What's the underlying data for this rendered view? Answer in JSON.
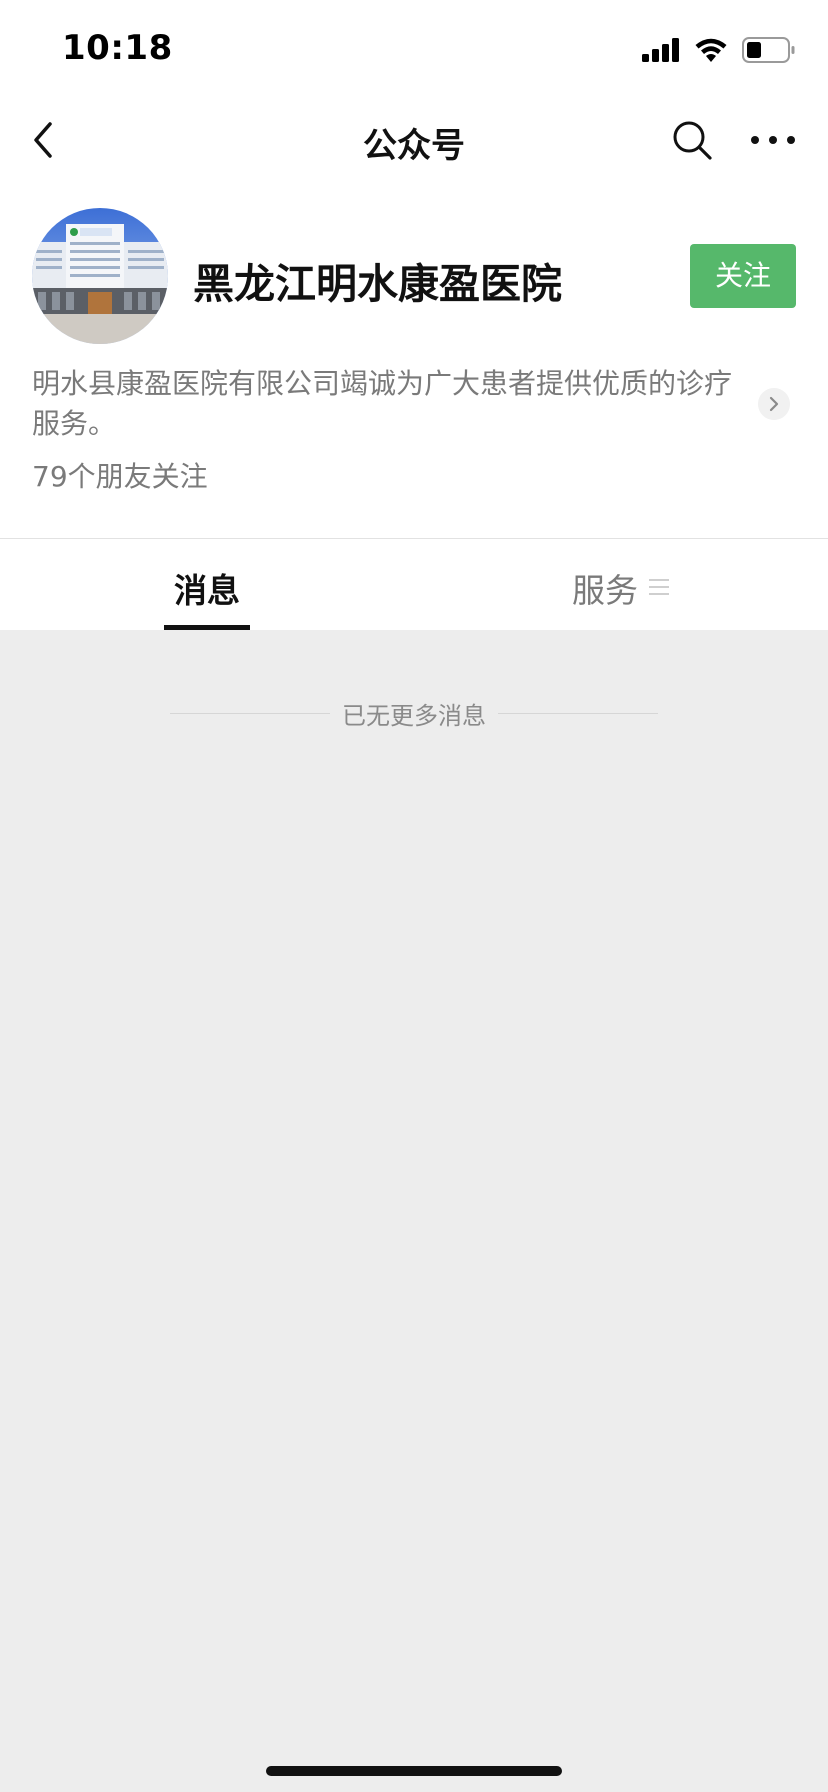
{
  "status_bar": {
    "time": "10:18"
  },
  "nav": {
    "title": "公众号",
    "back_icon": "chevron-left-icon",
    "search_icon": "search-icon",
    "more_icon": "more-dots-icon"
  },
  "account": {
    "name": "黑龙江明水康盈医院",
    "follow_label": "关注",
    "description": "明水县康盈医院有限公司竭诚为广大患者提供优质的诊疗服务。",
    "friends_following": "79个朋友关注"
  },
  "tabs": [
    {
      "label": "消息",
      "active": true
    },
    {
      "label": "服务",
      "active": false
    }
  ],
  "messages": {
    "end_text": "已无更多消息"
  },
  "colors": {
    "follow_green": "#56b86b",
    "background": "#ededed"
  }
}
